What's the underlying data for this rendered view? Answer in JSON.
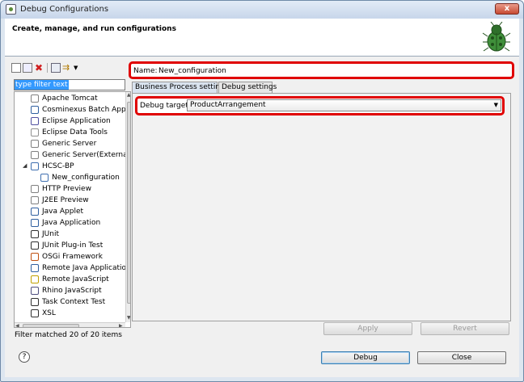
{
  "window": {
    "title": "Debug Configurations",
    "close_label": "x"
  },
  "banner": {
    "title": "Create, manage, and run configurations"
  },
  "left": {
    "filter_placeholder": "type filter text",
    "items": [
      {
        "label": "Apache Tomcat",
        "icon": "server-icon",
        "color": "#808080"
      },
      {
        "label": "Cosminexus Batch Applica",
        "icon": "batch-icon",
        "color": "#3060a0"
      },
      {
        "label": "Eclipse Application",
        "icon": "eclipse-icon",
        "color": "#5050a0"
      },
      {
        "label": "Eclipse Data Tools",
        "icon": "database-icon",
        "color": "#909090"
      },
      {
        "label": "Generic Server",
        "icon": "server-icon",
        "color": "#808080"
      },
      {
        "label": "Generic Server(External L",
        "icon": "server-icon",
        "color": "#808080"
      },
      {
        "label": "HCSC-BP",
        "icon": "hcsc-icon",
        "color": "#4070b0"
      },
      {
        "label": "New_configuration",
        "icon": "hcsc-config-icon",
        "color": "#4070b0"
      },
      {
        "label": "HTTP Preview",
        "icon": "server-icon",
        "color": "#808080"
      },
      {
        "label": "J2EE Preview",
        "icon": "server-icon",
        "color": "#808080"
      },
      {
        "label": "Java Applet",
        "icon": "applet-icon",
        "color": "#3060a0"
      },
      {
        "label": "Java Application",
        "icon": "java-app-icon",
        "color": "#3060a0"
      },
      {
        "label": "JUnit",
        "icon": "junit-icon",
        "color": "#303030"
      },
      {
        "label": "JUnit Plug-in Test",
        "icon": "junit-plugin-icon",
        "color": "#303030"
      },
      {
        "label": "OSGi Framework",
        "icon": "osgi-icon",
        "color": "#c05010"
      },
      {
        "label": "Remote Java Application",
        "icon": "remote-java-icon",
        "color": "#3060a0"
      },
      {
        "label": "Remote JavaScript",
        "icon": "remote-js-icon",
        "color": "#c0a000"
      },
      {
        "label": "Rhino JavaScript",
        "icon": "rhino-icon",
        "color": "#505080"
      },
      {
        "label": "Task Context Test",
        "icon": "task-icon",
        "color": "#303030"
      },
      {
        "label": "XSL",
        "icon": "xsl-icon",
        "color": "#303030"
      }
    ],
    "matched": "Filter matched 20 of 20 items"
  },
  "right": {
    "name_label": "Name:",
    "name_value": "New_configuration",
    "tabs": [
      {
        "label": "Business Process settings"
      },
      {
        "label": "Debug settings"
      }
    ],
    "debug_target_label": "Debug target:",
    "debug_target_value": "ProductArrangement",
    "apply_label": "Apply",
    "revert_label": "Revert"
  },
  "footer": {
    "help_label": "?",
    "debug_label": "Debug",
    "close_label": "Close"
  },
  "colors": {
    "highlight": "#e00000",
    "selection": "#3399ff"
  }
}
